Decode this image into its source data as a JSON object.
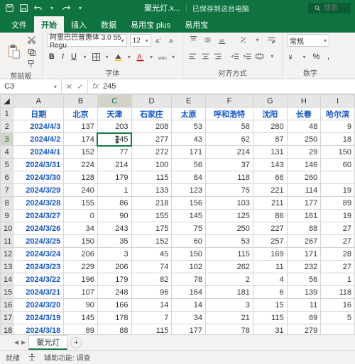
{
  "title": {
    "filename": "聚光灯.x...",
    "saved": "已保存到这台电脑",
    "search_placeholder": "搜索"
  },
  "tabs": [
    "文件",
    "开始",
    "插入",
    "数据",
    "易用宝 plus",
    "易用宝"
  ],
  "active_tab": 1,
  "ribbon": {
    "paste": "粘贴",
    "clipboard": "剪贴板",
    "font_name": "阿里巴巴普惠体 3.0 55 Regu",
    "font_size": "12",
    "font_group": "字体",
    "align_group": "对齐方式",
    "number_format": "常规",
    "number_group": "数字"
  },
  "namebox": "C3",
  "formula": "245",
  "columns": [
    "A",
    "B",
    "C",
    "D",
    "E",
    "F",
    "G",
    "H",
    "I"
  ],
  "header_row": [
    "日期",
    "北京",
    "天津",
    "石家庄",
    "太原",
    "呼和浩特",
    "沈阳",
    "长春",
    "哈尔滨"
  ],
  "rows": [
    {
      "n": 2,
      "d": "2024/4/3",
      "v": [
        "137",
        "203",
        "208",
        "53",
        "58",
        "280",
        "48",
        "9"
      ]
    },
    {
      "n": 3,
      "d": "2024/4/2",
      "v": [
        "174",
        "245",
        "277",
        "43",
        "62",
        "87",
        "250",
        "18"
      ]
    },
    {
      "n": 4,
      "d": "2024/4/1",
      "v": [
        "152",
        "77",
        "272",
        "171",
        "214",
        "131",
        "29",
        "150"
      ]
    },
    {
      "n": 5,
      "d": "2024/3/31",
      "v": [
        "224",
        "214",
        "100",
        "56",
        "37",
        "143",
        "146",
        "60"
      ]
    },
    {
      "n": 6,
      "d": "2024/3/30",
      "v": [
        "128",
        "179",
        "115",
        "84",
        "118",
        "66",
        "260",
        ""
      ]
    },
    {
      "n": 7,
      "d": "2024/3/29",
      "v": [
        "240",
        "1",
        "133",
        "123",
        "75",
        "221",
        "114",
        "19"
      ]
    },
    {
      "n": 8,
      "d": "2024/3/28",
      "v": [
        "155",
        "86",
        "218",
        "156",
        "103",
        "211",
        "177",
        "89"
      ]
    },
    {
      "n": 9,
      "d": "2024/3/27",
      "v": [
        "0",
        "90",
        "155",
        "145",
        "125",
        "86",
        "161",
        "19"
      ]
    },
    {
      "n": 10,
      "d": "2024/3/26",
      "v": [
        "34",
        "243",
        "175",
        "75",
        "250",
        "227",
        "88",
        "27"
      ]
    },
    {
      "n": 11,
      "d": "2024/3/25",
      "v": [
        "150",
        "35",
        "152",
        "60",
        "53",
        "257",
        "267",
        "27"
      ]
    },
    {
      "n": 12,
      "d": "2024/3/24",
      "v": [
        "206",
        "3",
        "45",
        "150",
        "115",
        "169",
        "171",
        "28"
      ]
    },
    {
      "n": 13,
      "d": "2024/3/23",
      "v": [
        "229",
        "206",
        "74",
        "102",
        "262",
        "11",
        "232",
        "27"
      ]
    },
    {
      "n": 14,
      "d": "2024/3/22",
      "v": [
        "196",
        "179",
        "82",
        "78",
        "2",
        "4",
        "56",
        "1"
      ]
    },
    {
      "n": 15,
      "d": "2024/3/21",
      "v": [
        "107",
        "248",
        "96",
        "164",
        "181",
        "6",
        "139",
        "118"
      ]
    },
    {
      "n": 16,
      "d": "2024/3/20",
      "v": [
        "90",
        "166",
        "14",
        "14",
        "3",
        "15",
        "11",
        "16"
      ]
    },
    {
      "n": 17,
      "d": "2024/3/19",
      "v": [
        "145",
        "178",
        "7",
        "34",
        "21",
        "115",
        "69",
        "5"
      ]
    },
    {
      "n": 18,
      "d": "2024/3/18",
      "v": [
        "89",
        "88",
        "115",
        "177",
        "78",
        "31",
        "279",
        ""
      ]
    }
  ],
  "sheet": "聚光灯",
  "status": {
    "ready": "就绪",
    "acc": "辅助功能: 调查"
  },
  "chart_data": {
    "type": "table",
    "title": "聚光灯",
    "columns": [
      "日期",
      "北京",
      "天津",
      "石家庄",
      "太原",
      "呼和浩特",
      "沈阳",
      "长春",
      "哈尔滨"
    ]
  }
}
